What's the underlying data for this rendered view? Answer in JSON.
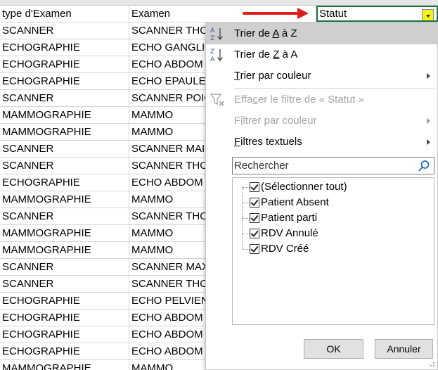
{
  "sheet": {
    "headers": {
      "col_a": "type d'Examen",
      "col_b": "Examen",
      "col_c": "Statut"
    },
    "rows": [
      {
        "a": "SCANNER",
        "b": "SCANNER THO"
      },
      {
        "a": "ECHOGRAPHIE",
        "b": "ECHO GANGLIO"
      },
      {
        "a": "ECHOGRAPHIE",
        "b": "ECHO ABDOM"
      },
      {
        "a": "ECHOGRAPHIE",
        "b": "ECHO EPAULE"
      },
      {
        "a": "SCANNER",
        "b": "SCANNER POIG"
      },
      {
        "a": "MAMMOGRAPHIE",
        "b": "MAMMO"
      },
      {
        "a": "MAMMOGRAPHIE",
        "b": "MAMMO"
      },
      {
        "a": "SCANNER",
        "b": "SCANNER MAI"
      },
      {
        "a": "SCANNER",
        "b": "SCANNER THO"
      },
      {
        "a": "ECHOGRAPHIE",
        "b": "ECHO ABDOM"
      },
      {
        "a": "MAMMOGRAPHIE",
        "b": "MAMMO"
      },
      {
        "a": "SCANNER",
        "b": "SCANNER THO"
      },
      {
        "a": "MAMMOGRAPHIE",
        "b": "MAMMO"
      },
      {
        "a": "MAMMOGRAPHIE",
        "b": "MAMMO"
      },
      {
        "a": "SCANNER",
        "b": "SCANNER MAX"
      },
      {
        "a": "SCANNER",
        "b": "SCANNER THO"
      },
      {
        "a": "ECHOGRAPHIE",
        "b": "ECHO PELVIEN"
      },
      {
        "a": "ECHOGRAPHIE",
        "b": "ECHO ABDOM"
      },
      {
        "a": "ECHOGRAPHIE",
        "b": "ECHO ABDOM"
      },
      {
        "a": "ECHOGRAPHIE",
        "b": "ECHO ABDOM"
      },
      {
        "a": "MAMMOGRAPHIE",
        "b": "MAMMO"
      }
    ]
  },
  "filter_menu": {
    "sort_az": {
      "pre": "Trier de ",
      "k1": "A",
      "mid": " à Z",
      "post": ""
    },
    "sort_za": {
      "pre": "Trier de ",
      "k1": "Z",
      "mid": " à A",
      "post": ""
    },
    "sort_color": {
      "k": "T",
      "rest": "rier par couleur"
    },
    "clear_filter": {
      "pre": "Effa",
      "k": "c",
      "rest": "er le filtre de « Statut »"
    },
    "filter_color": {
      "pre": "F",
      "k": "i",
      "rest": "ltrer par couleur"
    },
    "text_filters": {
      "k": "F",
      "rest": "iltres textuels"
    },
    "search_placeholder": "Rechercher",
    "items": [
      {
        "label": "(Sélectionner tout)",
        "checked": true
      },
      {
        "label": "Patient Absent",
        "checked": true
      },
      {
        "label": "Patient parti",
        "checked": true
      },
      {
        "label": "RDV Annulé",
        "checked": true
      },
      {
        "label": "RDV Créé",
        "checked": true
      }
    ],
    "ok_label": "OK",
    "cancel_label": "Annuler"
  },
  "colors": {
    "arrow": "#e21b1b",
    "filter_button": "#f5f11a",
    "highlight": "#cfcfcf"
  }
}
